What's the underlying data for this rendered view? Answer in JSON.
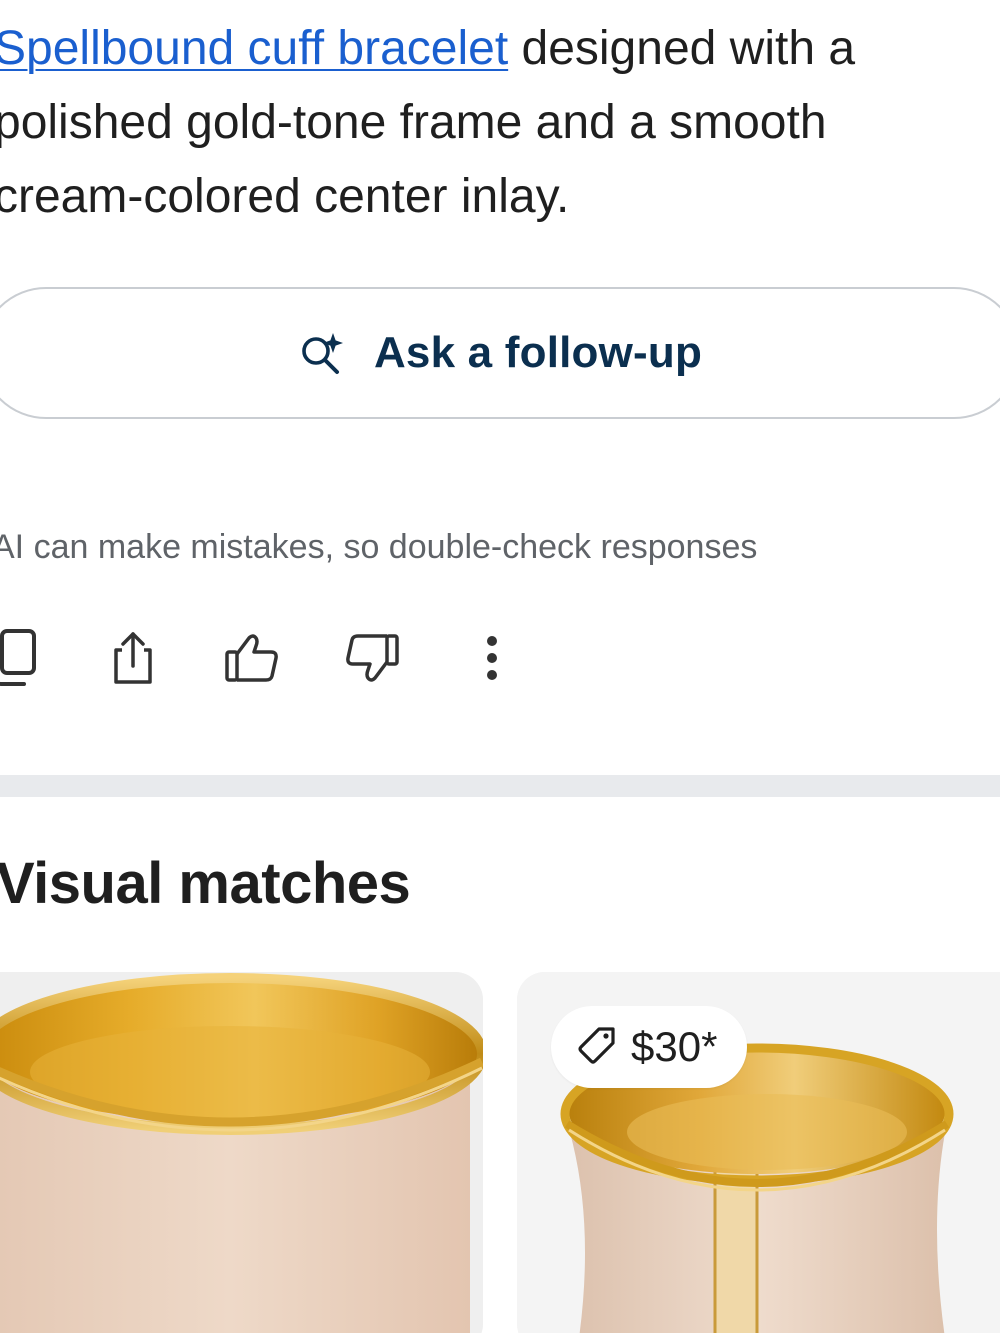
{
  "answer": {
    "link_text": "Spellbound cuff bracelet",
    "line1_rest": " designed with a",
    "line2": "polished gold-tone frame and a smooth",
    "line3": "cream-colored center inlay."
  },
  "followup": {
    "label": "Ask a follow-up",
    "icon": "search-sparkle-icon"
  },
  "disclaimer": "AI can make mistakes, so double-check responses",
  "actions": [
    {
      "name": "copy",
      "icon": "copy-icon"
    },
    {
      "name": "share",
      "icon": "share-icon"
    },
    {
      "name": "thumbs-up",
      "icon": "thumbs-up-icon"
    },
    {
      "name": "thumbs-down",
      "icon": "thumbs-down-icon"
    },
    {
      "name": "more",
      "icon": "more-vert-icon"
    }
  ],
  "visual_matches": {
    "title": "Visual matches",
    "items": [
      {
        "image": "cream-gold-cuff-bracelet-photo"
      },
      {
        "image": "cream-gold-cuff-bracelet-photo",
        "price": "$30*",
        "price_icon": "price-tag-icon"
      }
    ]
  },
  "colors": {
    "link": "#1a5fcf",
    "text": "#1f1f1f",
    "muted": "#5f6368",
    "button_border": "#c9cdd2",
    "followup_text": "#0b2f4f",
    "divider": "#e8eaed",
    "gold": "#d9a21b",
    "cream": "#ead2bf"
  }
}
